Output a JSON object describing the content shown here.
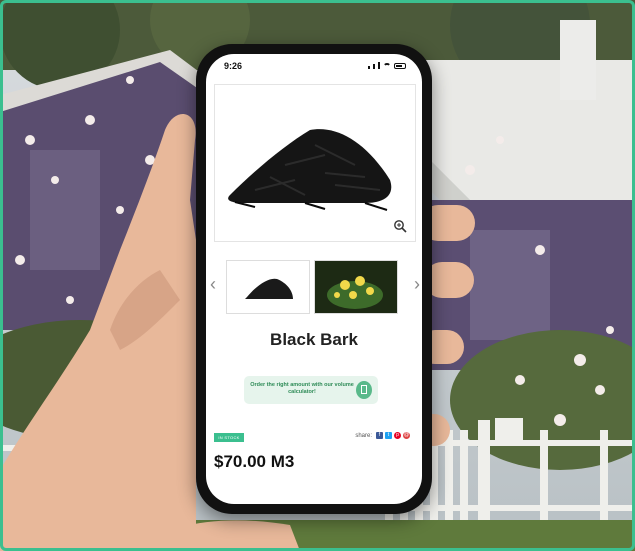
{
  "status_bar": {
    "time": "9:26"
  },
  "product": {
    "title": "Black Bark",
    "price": "$70.00 M3",
    "stock_badge": "IN STOCK"
  },
  "calculator_banner": {
    "text": "Order the right amount with our volume calculator!"
  },
  "share": {
    "label": "share:"
  },
  "icons": {
    "zoom": "zoom-in-icon",
    "prev": "chevron-left-icon",
    "next": "chevron-right-icon",
    "calculator": "calculator-icon",
    "facebook": "facebook-icon",
    "twitter": "twitter-icon",
    "pinterest": "pinterest-icon",
    "email": "email-icon"
  },
  "colors": {
    "accent": "#3bbf8f",
    "banner_bg": "#e6f4ec",
    "banner_text": "#2e8b57"
  }
}
